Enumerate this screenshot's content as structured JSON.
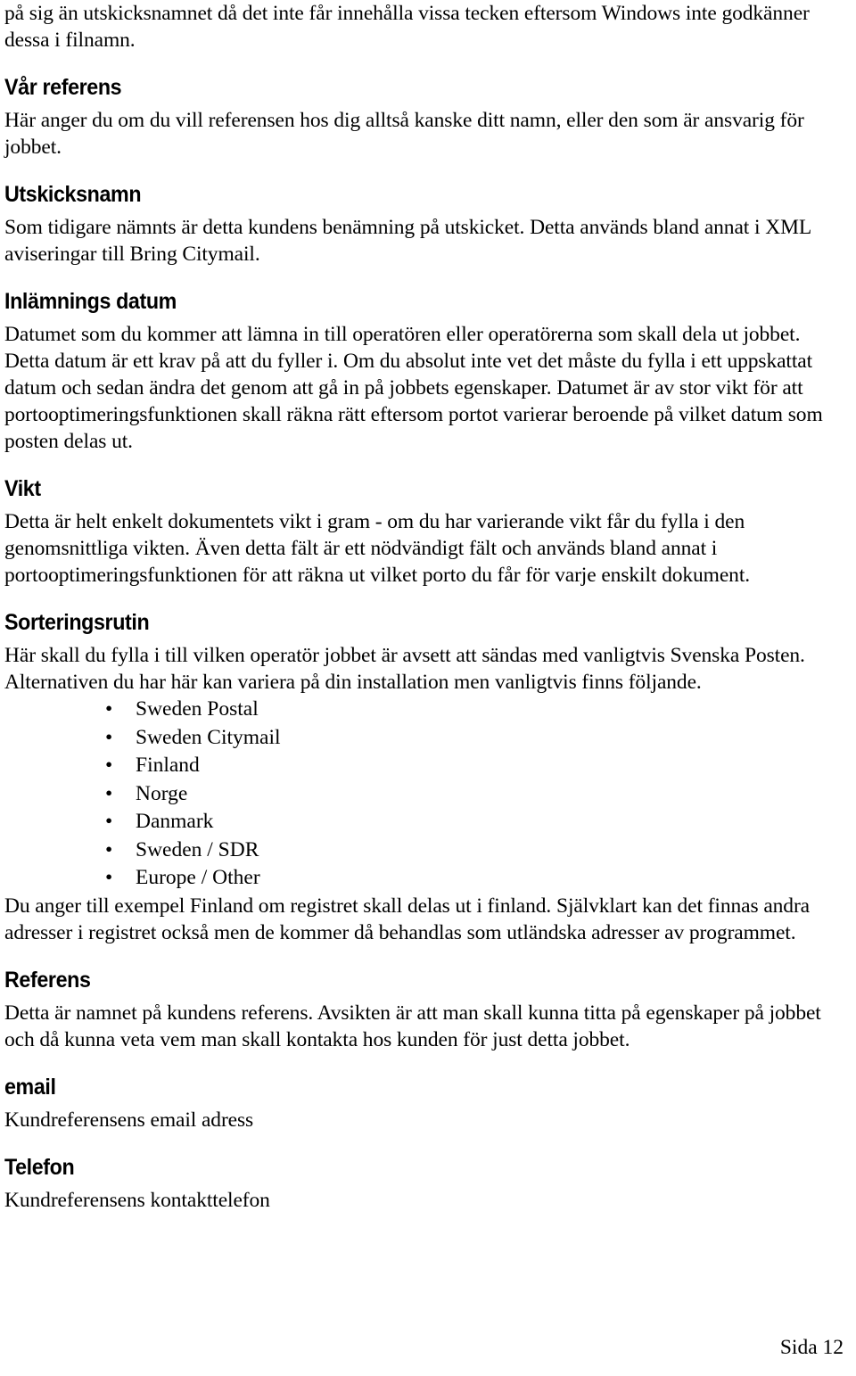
{
  "document": {
    "page_footer": "Sida 12",
    "intro_paragraph": "på sig än utskicksnamnet då det inte får innehålla vissa tecken eftersom Windows inte godkänner dessa i filnamn.",
    "sections": [
      {
        "heading": "Vår referens",
        "paragraph": "Här anger du om du vill referensen hos dig alltså kanske ditt namn, eller den som är ansvarig för jobbet."
      },
      {
        "heading": "Utskicksnamn",
        "paragraph": "Som tidigare nämnts är detta kundens benämning på utskicket. Detta används bland annat i XML aviseringar till Bring Citymail."
      },
      {
        "heading": "Inlämnings datum",
        "paragraph": "Datumet som du kommer att lämna in till operatören eller operatörerna som skall dela ut jobbet. Detta datum är ett krav på att du fyller i. Om du absolut inte vet det måste du fylla i ett uppskattat datum och sedan ändra det genom att gå in på jobbets egenskaper. Datumet är av stor vikt för att portooptimeringsfunktionen skall räkna rätt eftersom portot varierar beroende på vilket datum som posten delas ut."
      },
      {
        "heading": "Vikt",
        "paragraph": "Detta är helt enkelt dokumentets vikt i gram - om du har varierande vikt får du fylla i den genomsnittliga vikten. Även detta fält är ett nödvändigt fält och används bland annat i portooptimeringsfunktionen för att räkna ut vilket porto du får för varje enskilt dokument."
      },
      {
        "heading": "Sorteringsrutin",
        "paragraph": "Här skall du fylla i till vilken operatör jobbet är avsett att sändas med vanligtvis Svenska Posten. Alternativen du har här kan variera på din installation men vanligtvis finns följande.",
        "list": [
          "Sweden Postal",
          "Sweden Citymail",
          "Finland",
          "Norge",
          "Danmark",
          "Sweden / SDR",
          "Europe / Other"
        ],
        "paragraph_after_list": "Du anger till exempel Finland om registret skall delas ut i finland. Självklart kan det finnas andra adresser i registret också men de kommer då behandlas som utländska adresser av programmet."
      },
      {
        "heading": "Referens",
        "paragraph": "Detta är namnet på kundens referens. Avsikten är att man skall kunna titta på egenskaper på jobbet och då kunna veta vem man skall kontakta hos kunden för just detta jobbet."
      },
      {
        "heading": "email",
        "paragraph": "Kundreferensens email adress"
      },
      {
        "heading": "Telefon",
        "paragraph": "Kundreferensens kontakttelefon"
      }
    ],
    "bullet_glyph": "•"
  }
}
